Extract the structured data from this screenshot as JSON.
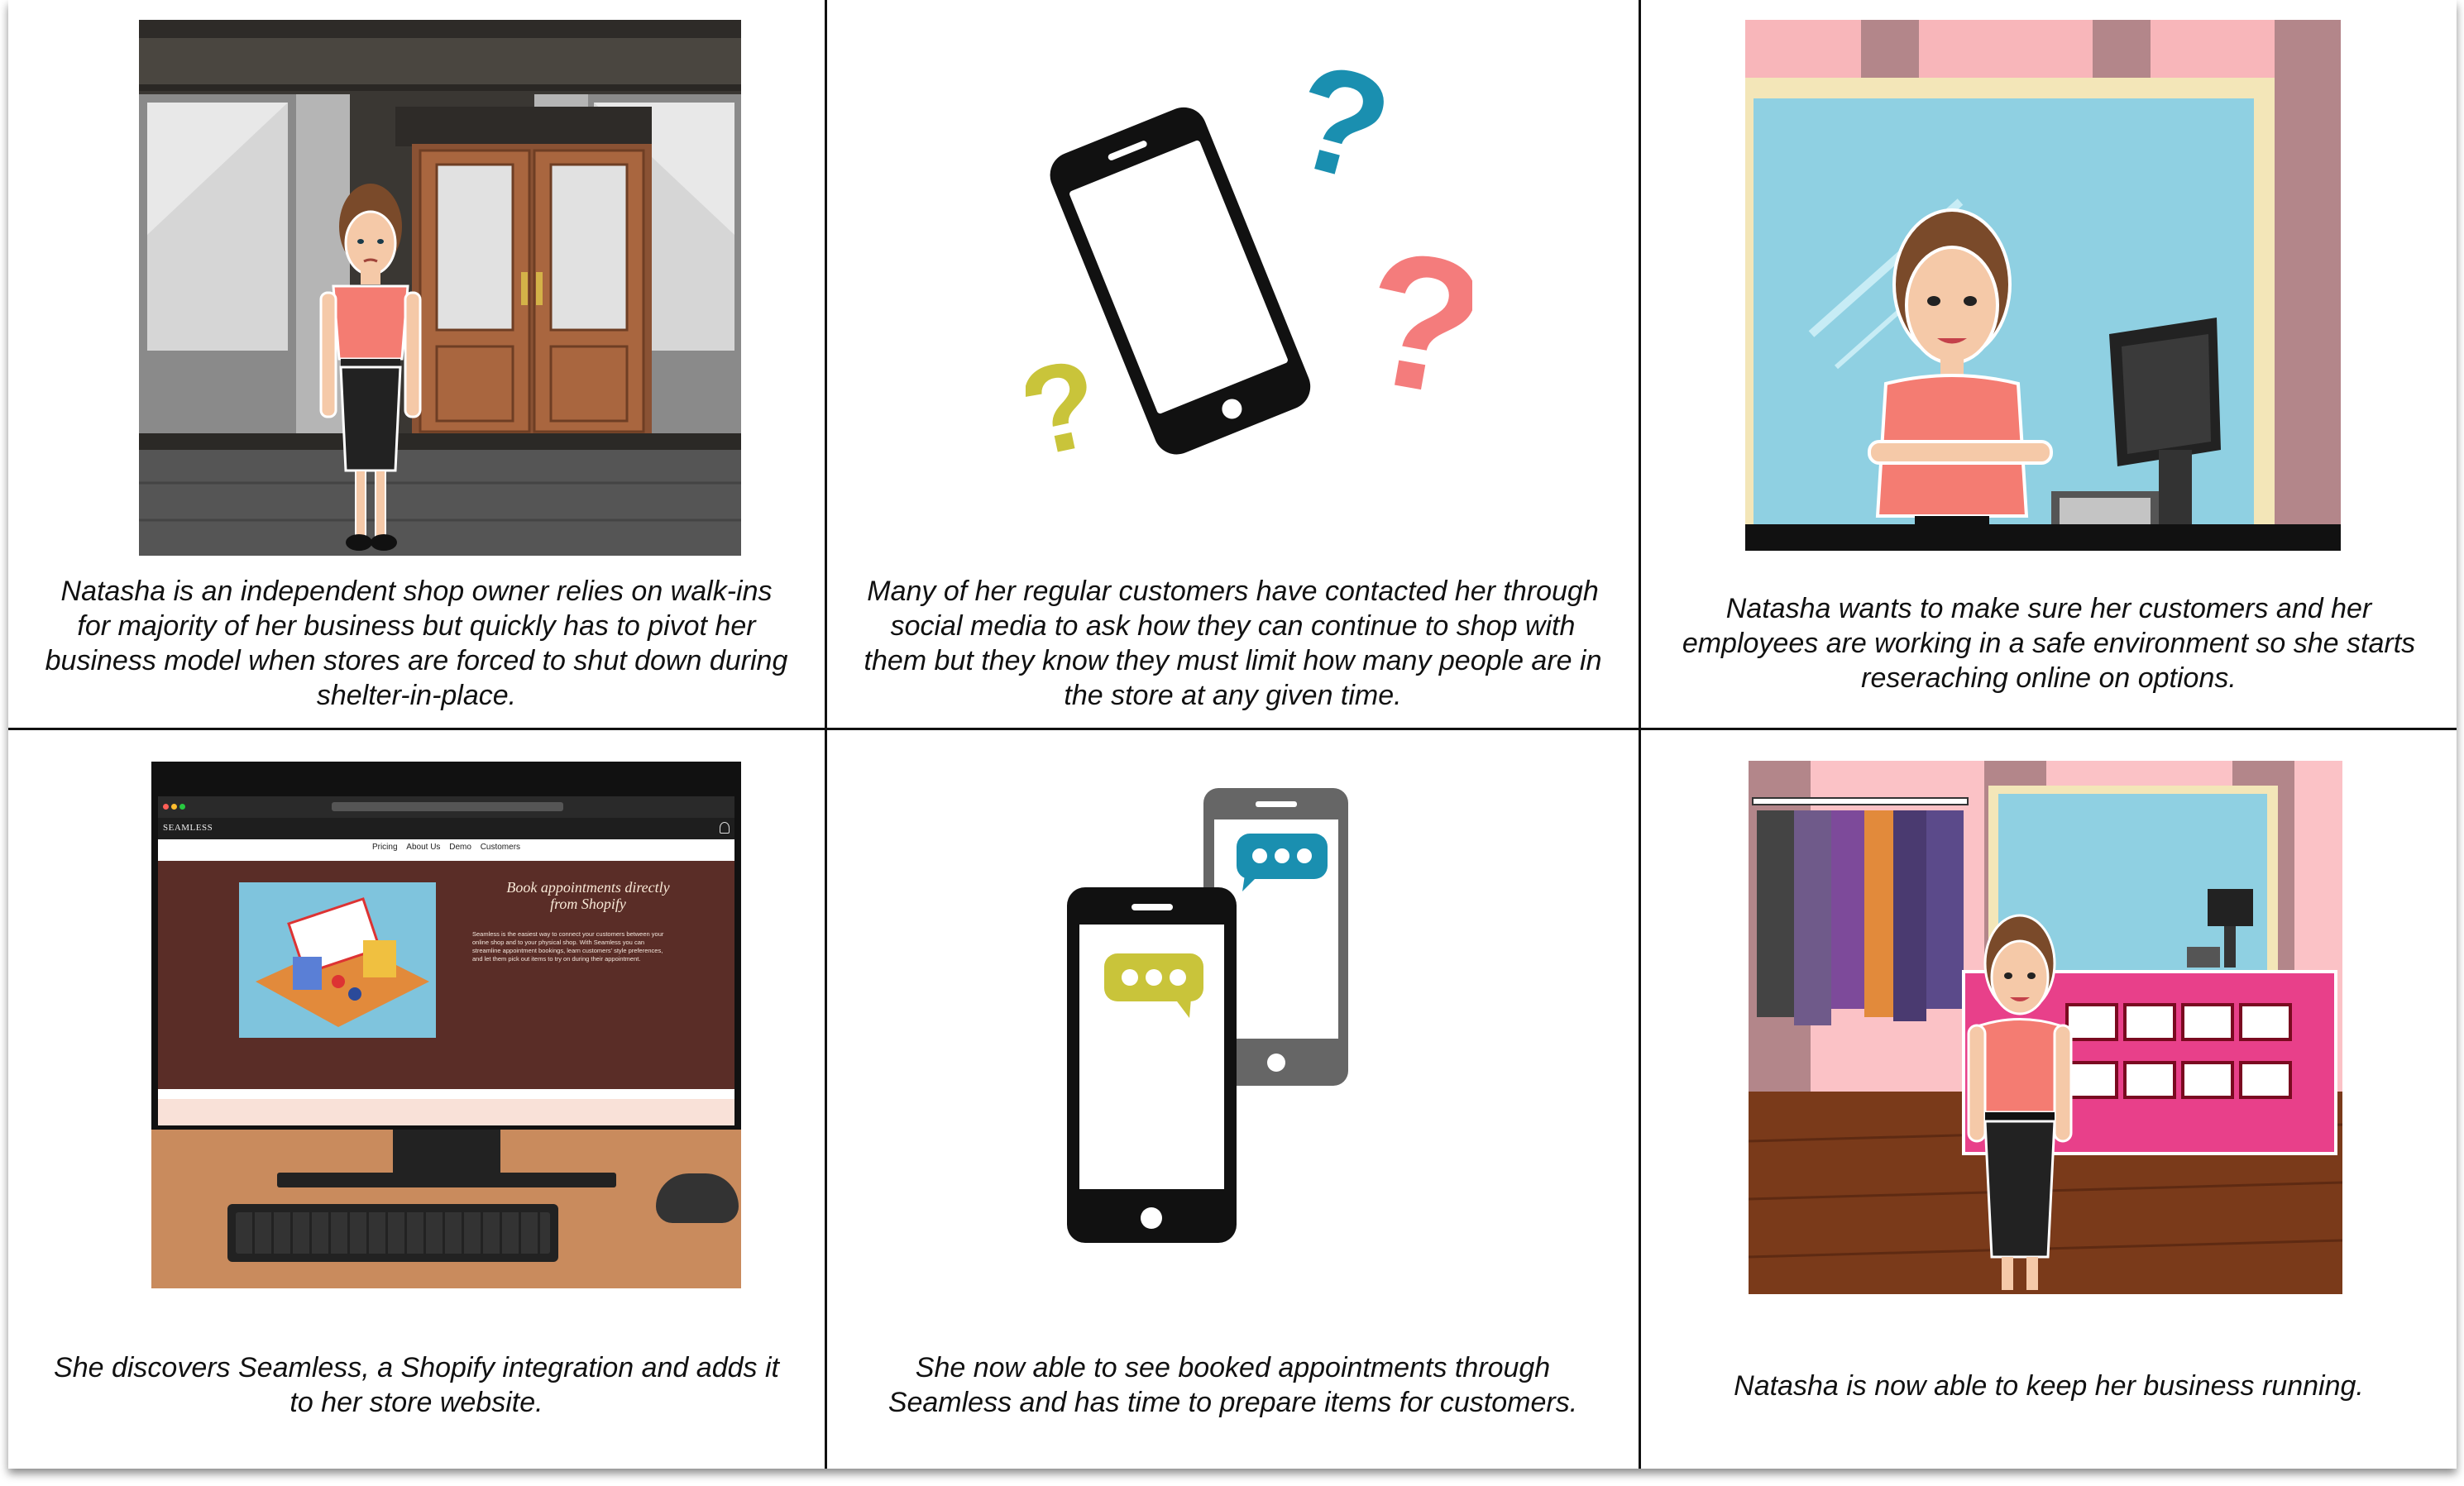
{
  "panels": [
    {
      "caption": "Natasha is an independent shop owner relies on walk-ins for majority of her business but quickly has to pivot her business model when stores are forced to shut down during shelter-in-place."
    },
    {
      "caption": "Many of her regular customers have contacted her through social media to ask how they can continue to shop with them but they know they must limit how many people are in the store at any given time."
    },
    {
      "caption": "Natasha wants to make sure her customers and her employees are working in a safe environment so she starts reseraching online on options."
    },
    {
      "caption": "She discovers Seamless, a Shopify integration and adds it to her store website."
    },
    {
      "caption": "She now able to see booked appointments through Seamless and has time to prepare items for customers."
    },
    {
      "caption": "Natasha is now able to keep her business running."
    }
  ],
  "website": {
    "brand": "SEAMLESS",
    "nav": [
      "Pricing",
      "About Us",
      "Demo",
      "Customers"
    ],
    "headline_line1": "Book appointments directly",
    "headline_line2": "from Shopify",
    "body": "Seamless is the easiest way to connect your customers between your online shop and to your physical shop. With Seamless you can streamline appointment bookings, learn customers' style preferences, and let them pick out items to try on during their appointment."
  },
  "colors": {
    "shirt": "#f47c72",
    "question_blue": "#1a8fb0",
    "question_pink": "#f47c7c",
    "question_yellow": "#c9c43a",
    "website_maroon": "#5a2d27",
    "desk": "#c98b5d",
    "shop_pink": "#e8408a"
  },
  "icons": [
    "question-mark-icon",
    "phone-icon",
    "chat-bubble-icon",
    "user-icon"
  ]
}
